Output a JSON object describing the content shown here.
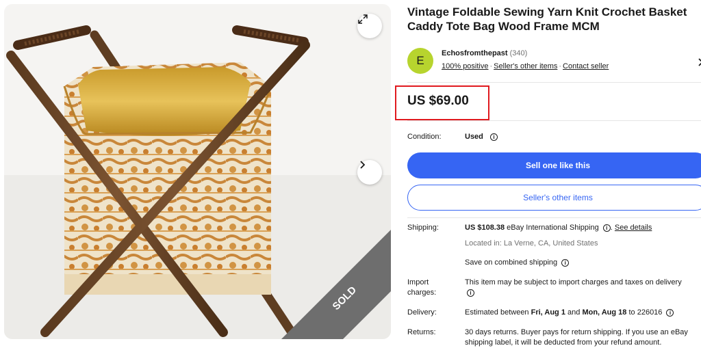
{
  "product": {
    "title": "Vintage Foldable Sewing Yarn Knit Crochet Basket Caddy Tote Bag Wood Frame MCM",
    "price": "US $69.00",
    "sold_banner": "SOLD"
  },
  "seller": {
    "avatar_letter": "E",
    "name": "Echosfromthepast",
    "feedback_count": "(340)",
    "positive": "100% positive",
    "other_items": "Seller's other items",
    "contact": "Contact seller"
  },
  "condition": {
    "label": "Condition:",
    "value": "Used"
  },
  "buttons": {
    "sell_one": "Sell one like this",
    "seller_other_items": "Seller's other items"
  },
  "shipping": {
    "label": "Shipping:",
    "amount": "US $108.38",
    "service": "eBay International Shipping",
    "see_details": "See details",
    "location": "Located in: La Verne, CA, United States",
    "combined": "Save on combined shipping"
  },
  "import": {
    "label_line1": "Import",
    "label_line2": "charges:",
    "text": "This item may be subject to import charges and taxes on delivery"
  },
  "delivery": {
    "label": "Delivery:",
    "prefix": "Estimated between",
    "date1": "Fri, Aug 1",
    "and": "and",
    "date2": "Mon, Aug 18",
    "to": "to 226016"
  },
  "returns": {
    "label": "Returns:",
    "line1": "30 days returns. Buyer pays for return shipping. If you use an eBay",
    "line2": "shipping label, it will be deducted from your refund amount."
  },
  "icons": {
    "expand": "expand-icon",
    "next": "chevron-right-icon",
    "info": "info-icon"
  },
  "colors": {
    "accent": "#3665f3",
    "highlight_box": "#e0191e",
    "avatar": "#b7d42e",
    "sold_banner": "#6e6e6e"
  }
}
